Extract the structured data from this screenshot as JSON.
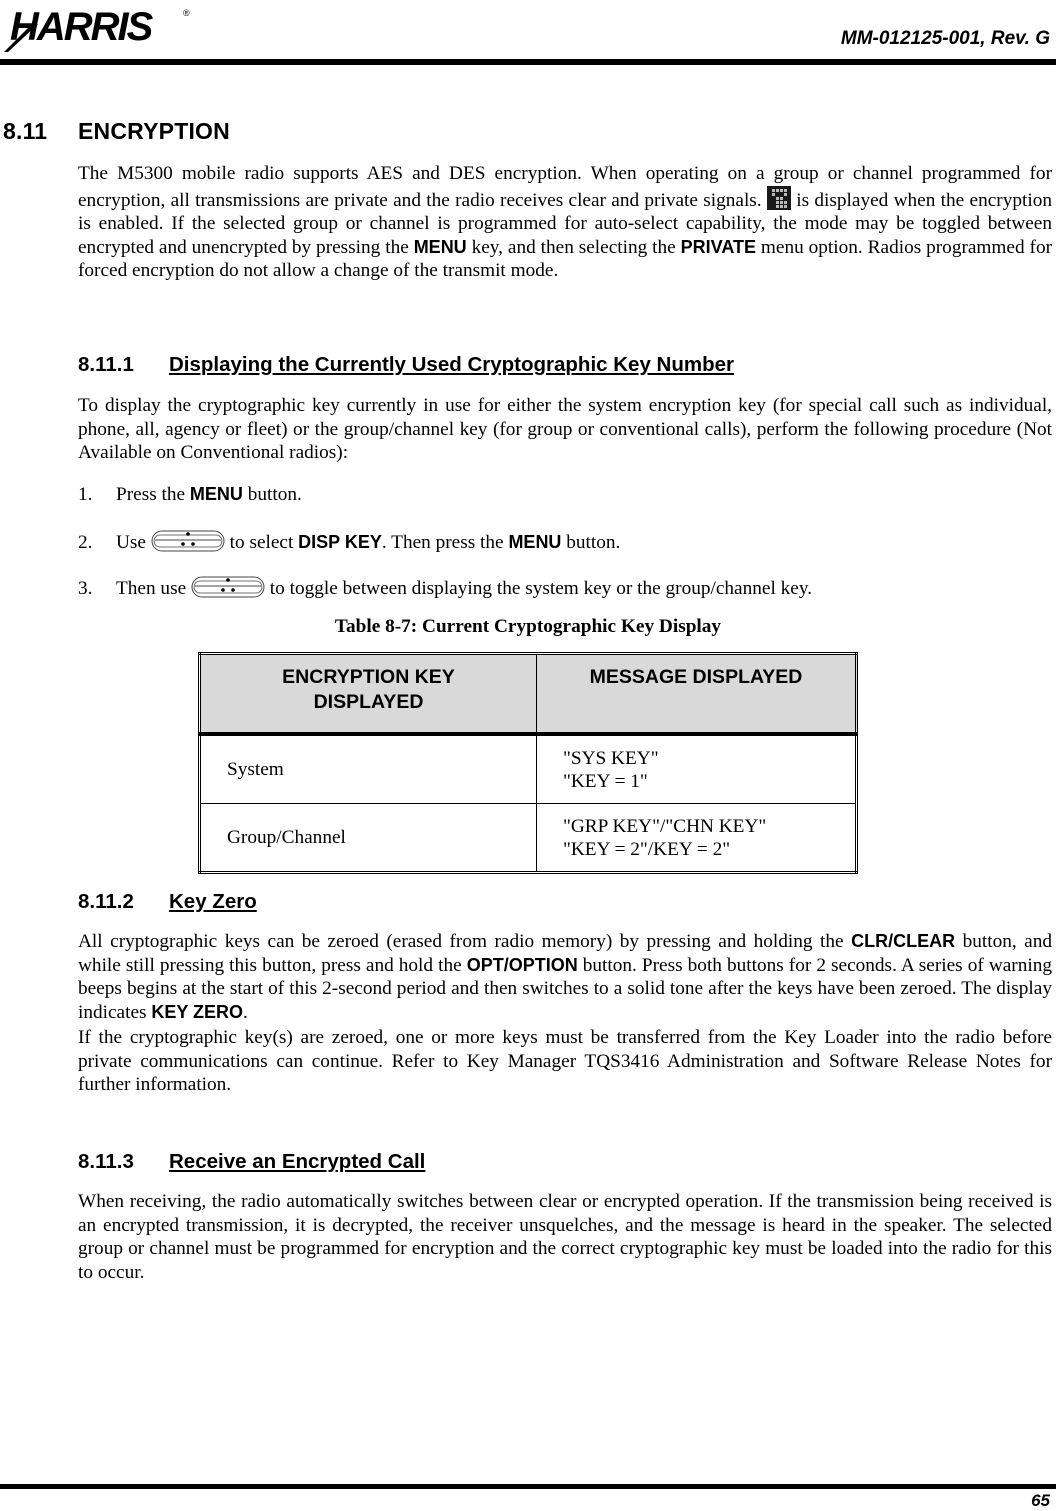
{
  "header": {
    "logo_text": "HARRIS",
    "doc_number": "MM-012125-001, Rev. G"
  },
  "section": {
    "number": "8.11",
    "title": "ENCRYPTION",
    "intro": {
      "p1": "The M5300 mobile radio supports AES and DES encryption. When operating on a group or channel programmed for encryption, all transmissions are private and the radio receives clear and private signals.",
      "icon": "encryption-lock-icon",
      "p2": " is displayed when the encryption is enabled. If the selected group or channel is programmed for auto-select capability, the mode may be toggled between encrypted and unencrypted by pressing the ",
      "menu": "MENU",
      "p3": " key, and then selecting the ",
      "private": "PRIVATE",
      "p4": " menu option. Radios programmed for forced encryption do not allow a change of the transmit mode."
    }
  },
  "sub1": {
    "number": "8.11.1",
    "title": "Displaying the Currently Used Cryptographic Key Number",
    "text": "To display the cryptographic key currently in use for either the system encryption key (for special call such as individual, phone, all, agency or fleet) or the group/channel key (for group or conventional calls), perform the following procedure (Not Available on Conventional radios):",
    "steps": [
      {
        "n": "1.",
        "a": "Press the ",
        "b": "MENU",
        "c": " button."
      },
      {
        "n": "2.",
        "a": "Use ",
        "b1": "to select ",
        "bold1": "DISP KEY",
        "c": ". Then press the ",
        "bold2": "MENU",
        "d": " button."
      },
      {
        "n": "3.",
        "a": "Then use ",
        "b": " to toggle between displaying the system key or the group/channel key."
      }
    ],
    "icon": "rocker-switch-icon"
  },
  "table": {
    "caption": "Table 8-7: Current Cryptographic Key Display",
    "headers": [
      "ENCRYPTION KEY DISPLAYED",
      "MESSAGE DISPLAYED"
    ],
    "header_lines": [
      [
        "ENCRYPTION KEY",
        "DISPLAYED"
      ],
      [
        "MESSAGE DISPLAYED"
      ]
    ],
    "rows": [
      {
        "key": "System",
        "msg": [
          "\"SYS KEY\"",
          "\"KEY = 1\""
        ]
      },
      {
        "key": "Group/Channel",
        "msg": [
          "\"GRP KEY\"/\"CHN KEY\"",
          "\"KEY = 2\"/KEY = 2\""
        ]
      }
    ],
    "header_bg": "#d9d9d9"
  },
  "sub2": {
    "number": "8.11.2",
    "title": "Key Zero",
    "p1": {
      "a": "All cryptographic keys can be zeroed (erased from radio memory) by pressing and holding the ",
      "b": "CLR/CLEAR",
      "c": " button, and while still pressing this button, press and hold the ",
      "d": "OPT/OPTION",
      "e": " button. Press both buttons for 2 seconds. A series of warning beeps begins at the start of this 2-second period and then switches to a solid tone after the keys have been zeroed. The display indicates ",
      "f": "KEY ZERO",
      "g": "."
    },
    "p2": "If the cryptographic key(s) are zeroed, one or more keys must be transferred from the Key Loader into the radio before private communications can continue. Refer to Key Manager TQS3416 Administration and Software Release Notes for further information."
  },
  "sub3": {
    "number": "8.11.3",
    "title": "Receive an Encrypted Call",
    "text": "When receiving, the radio automatically switches between clear or encrypted operation. If the transmission being received is an encrypted transmission, it is decrypted, the receiver unsquelches, and the message is heard in the speaker. The selected group or channel must be programmed for encryption and the correct cryptographic key must be loaded into the radio for this to occur."
  },
  "footer": {
    "page_number": "65"
  }
}
